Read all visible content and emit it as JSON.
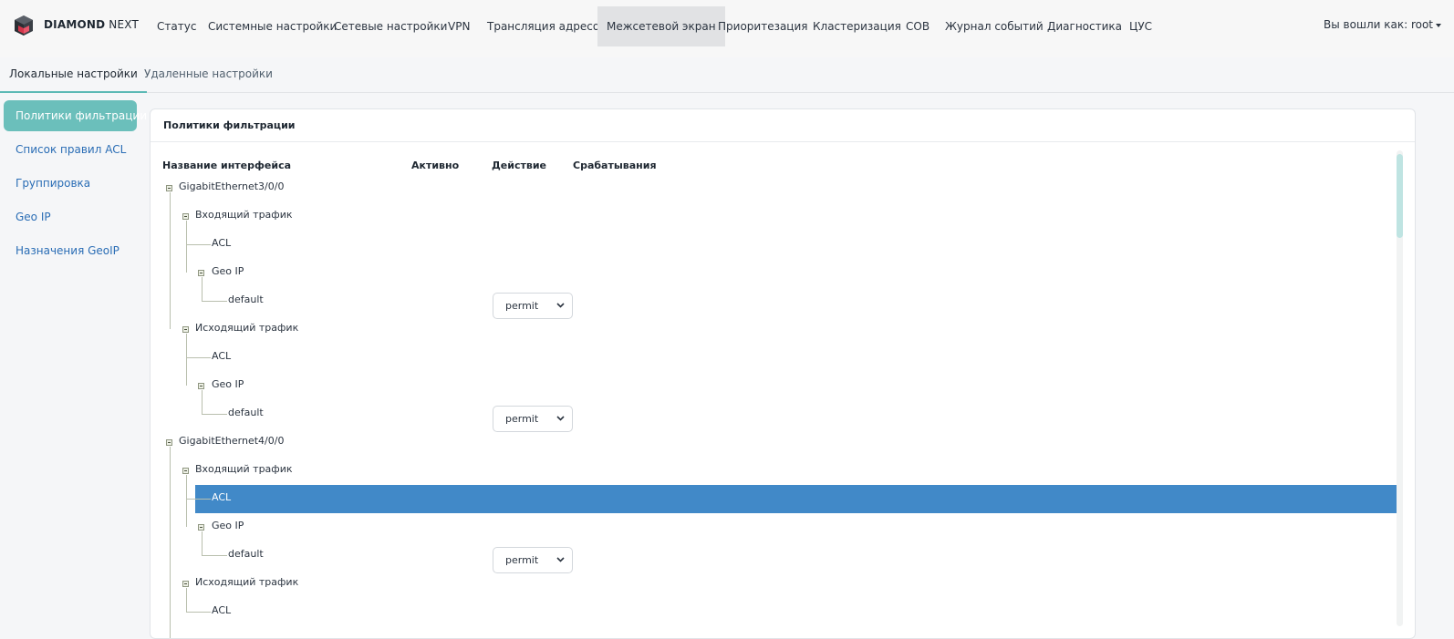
{
  "app": {
    "brand_bold": "DIAMOND",
    "brand_light": "NEXT"
  },
  "nav": {
    "items": [
      {
        "label": "Статус"
      },
      {
        "label": "Системные настройки"
      },
      {
        "label": "Сетевые настройки"
      },
      {
        "label": "VPN"
      },
      {
        "label": "Трансляция адресов"
      },
      {
        "label": "Межсетевой экран"
      },
      {
        "label": "Приоритезация"
      },
      {
        "label": "Кластеризация"
      },
      {
        "label": "СОВ"
      },
      {
        "label": "Журнал событий"
      },
      {
        "label": "Диагностика"
      },
      {
        "label": "ЦУС"
      }
    ],
    "active": "Межсетевой экран",
    "user_label": "Вы вошли как: root"
  },
  "subtabs": {
    "items": [
      {
        "label": "Локальные настройки"
      },
      {
        "label": "Удаленные настройки"
      }
    ],
    "active": "Локальные настройки"
  },
  "sidebar": {
    "items": [
      {
        "label": "Политики фильтрации"
      },
      {
        "label": "Список правил ACL"
      },
      {
        "label": "Группировка"
      },
      {
        "label": "Geo IP"
      },
      {
        "label": "Назначения GeoIP"
      }
    ],
    "active": "Политики фильтрации"
  },
  "panel": {
    "title": "Политики фильтрации",
    "columns": {
      "name": "Название интерфейса",
      "active": "Активно",
      "action": "Действие",
      "hits": "Срабатывания"
    }
  },
  "tree": {
    "nodes": [
      {
        "label": "GigabitEthernet3/0/0",
        "level": 0
      },
      {
        "label": "Входящий трафик",
        "level": 1
      },
      {
        "label": "ACL",
        "level": 2
      },
      {
        "label": "Geo IP",
        "level": 2
      },
      {
        "label": "default",
        "level": 3,
        "action": "permit"
      },
      {
        "label": "Исходящий трафик",
        "level": 1
      },
      {
        "label": "ACL",
        "level": 2
      },
      {
        "label": "Geo IP",
        "level": 2
      },
      {
        "label": "default",
        "level": 3,
        "action": "permit"
      },
      {
        "label": "GigabitEthernet4/0/0",
        "level": 0
      },
      {
        "label": "Входящий трафик",
        "level": 1
      },
      {
        "label": "ACL",
        "level": 2,
        "selected": true
      },
      {
        "label": "Geo IP",
        "level": 2
      },
      {
        "label": "default",
        "level": 3,
        "action": "permit"
      },
      {
        "label": "Исходящий трафик",
        "level": 1
      },
      {
        "label": "ACL",
        "level": 2
      }
    ]
  },
  "colors": {
    "accent": "#6bbfbb",
    "selection": "#4189c8",
    "link": "#2a6db5"
  }
}
